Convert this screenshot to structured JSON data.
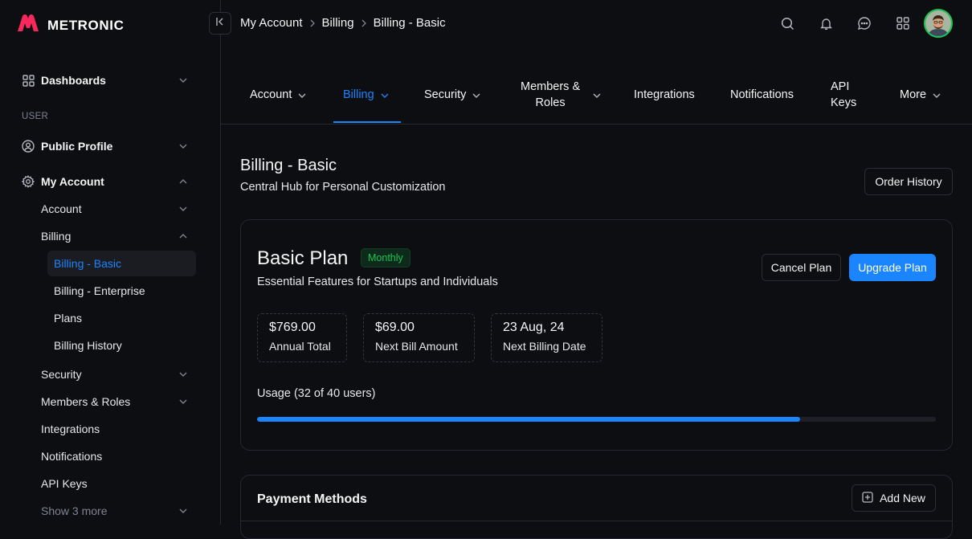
{
  "brand": {
    "name": "METRONIC",
    "logo_color": "#f8285a"
  },
  "colors": {
    "accent": "#1b84ff",
    "success": "#17c653",
    "bg": "#0d0e12",
    "border": "#26272f"
  },
  "sidebar": {
    "dashboards": "Dashboards",
    "section_user": "USER",
    "public_profile": "Public Profile",
    "my_account": "My Account",
    "account": "Account",
    "billing": "Billing",
    "billing_basic": "Billing - Basic",
    "billing_enterprise": "Billing - Enterprise",
    "plans": "Plans",
    "billing_history": "Billing History",
    "security": "Security",
    "members_roles": "Members & Roles",
    "integrations": "Integrations",
    "notifications": "Notifications",
    "api_keys": "API Keys",
    "show_more": "Show 3 more"
  },
  "breadcrumb": {
    "item1": "My Account",
    "item2": "Billing",
    "item3": "Billing - Basic"
  },
  "header_icons": [
    "search-icon",
    "bell-icon",
    "chat-icon",
    "apps-grid-icon",
    "user-avatar"
  ],
  "tabs": {
    "account": "Account",
    "billing": "Billing",
    "security": "Security",
    "members_line1": "Members &",
    "members_line2": "Roles",
    "integrations": "Integrations",
    "notifications": "Notifications",
    "api_line1": "API",
    "api_line2": "Keys",
    "more": "More"
  },
  "page": {
    "title": "Billing - Basic",
    "subtitle": "Central Hub for Personal Customization",
    "order_history": "Order History"
  },
  "plan": {
    "name": "Basic Plan",
    "badge": "Monthly",
    "description": "Essential Features for Startups and Individuals",
    "cancel": "Cancel Plan",
    "upgrade": "Upgrade Plan",
    "stats": [
      {
        "value": "$769.00",
        "label": "Annual Total"
      },
      {
        "value": "$69.00",
        "label": "Next Bill Amount"
      },
      {
        "value": "23 Aug, 24",
        "label": "Next Billing Date"
      }
    ],
    "usage_label": "Usage (32 of 40 users)",
    "usage_fraction": 0.8
  },
  "payment": {
    "title": "Payment Methods",
    "add_new": "Add New"
  }
}
